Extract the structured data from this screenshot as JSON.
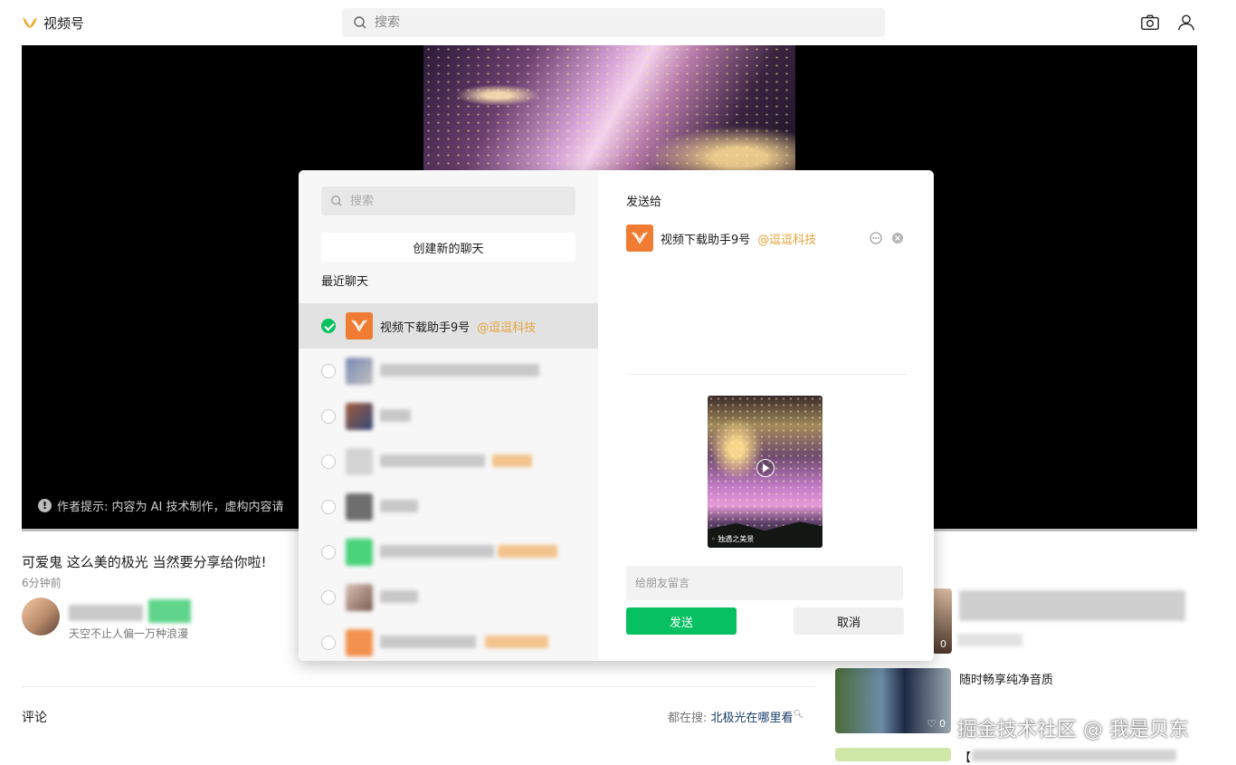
{
  "header": {
    "logo_text": "视频号",
    "search_placeholder": "搜索"
  },
  "video": {
    "ai_hint": "作者提示: 内容为 AI 技术制作，虚构内容请"
  },
  "post": {
    "title": "可爱鬼 这么美的极光 当然要分享给你啦!",
    "time": "6分钟前",
    "author_desc": "天空不止人偏一万种浪漫"
  },
  "comments": {
    "label": "评论",
    "trending_prefix": "都在搜:",
    "trending_keyword": "北极光在哪里看"
  },
  "recommendations": [
    {
      "title": "",
      "likes": "0"
    },
    {
      "title": "随时畅享纯净音质",
      "likes": "0"
    },
    {
      "title": "【"
    }
  ],
  "watermark": "掘金技术社区 @ 我是贝东",
  "share_modal": {
    "search_placeholder": "搜索",
    "new_chat_label": "创建新的聊天",
    "recent_label": "最近聊天",
    "chats": [
      {
        "name": "视频下载助手9号",
        "org": "@逗逗科技",
        "selected": true
      },
      {
        "name": "",
        "org": "",
        "selected": false
      },
      {
        "name": "",
        "org": "",
        "selected": false
      },
      {
        "name": "",
        "org": "",
        "selected": false
      },
      {
        "name": "",
        "org": "",
        "selected": false
      },
      {
        "name": "",
        "org": "",
        "selected": false
      },
      {
        "name": "",
        "org": "",
        "selected": false
      },
      {
        "name": "",
        "org": "",
        "selected": false
      }
    ],
    "send_to_label": "发送给",
    "target": {
      "name": "视频下载助手9号",
      "org": "@逗逗科技"
    },
    "preview_tag": "独遇之美景",
    "message_placeholder": "给朋友留言",
    "send_label": "发送",
    "cancel_label": "取消"
  },
  "colors": {
    "accent_green": "#07c160",
    "brand_orange": "#f07c33",
    "org_text": "#e6a23c"
  }
}
